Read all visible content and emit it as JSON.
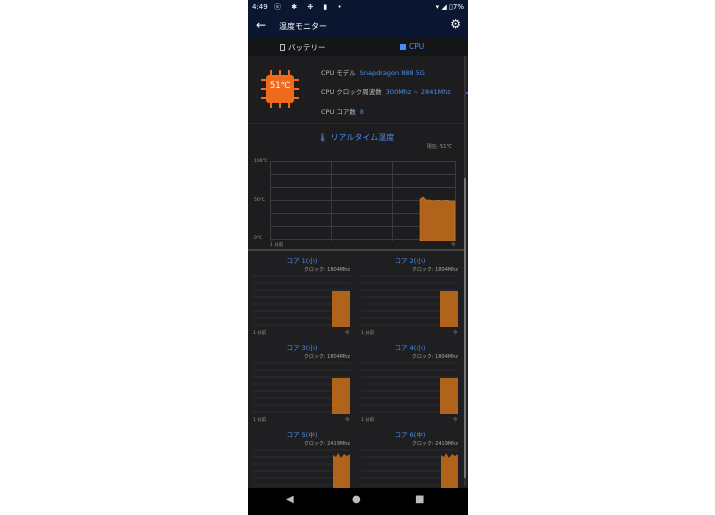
{
  "status_bar": {
    "time": "4:49",
    "icons_left": "ⓔ ✱ ❉ ▮ •",
    "battery": "7%"
  },
  "app_bar": {
    "title": "温度モニター",
    "back_icon": "←",
    "settings_icon": "⚙"
  },
  "tabs": [
    {
      "label": "バッテリー",
      "selected": false
    },
    {
      "label": "CPU",
      "selected": true
    }
  ],
  "cpu_info": {
    "temperature": "51℃",
    "model_label": "CPU モデル",
    "model_value": "Snapdragon 888 5G",
    "clock_label": "CPU クロック周波数",
    "clock_value": "300Mhz ~ 2841Mhz",
    "cores_label": "CPU コア数",
    "cores_value": "8"
  },
  "realtime": {
    "title": "リアルタイム温度",
    "current": "現在: 51℃",
    "y_labels": [
      "100℃",
      "50℃",
      "0℃"
    ],
    "x_left": "1 分前",
    "x_right": "今",
    "fill_color": "#b0631b"
  },
  "cores": [
    {
      "name": "コア 1(小)",
      "clock": "クロック: 1804Mhz",
      "x_left": "1 分前",
      "x_right": "今",
      "shape": "flat"
    },
    {
      "name": "コア 2(小)",
      "clock": "クロック: 1804Mhz",
      "x_left": "1 分前",
      "x_right": "今",
      "shape": "flat"
    },
    {
      "name": "コア 3(小)",
      "clock": "クロック: 1804Mhz",
      "x_left": "1 分前",
      "x_right": "今",
      "shape": "flat"
    },
    {
      "name": "コア 4(小)",
      "clock": "クロック: 1804Mhz",
      "x_left": "1 分前",
      "x_right": "今",
      "shape": "flat"
    },
    {
      "name": "コア 5(中)",
      "clock": "クロック: 2419Mhz",
      "shape": "wave"
    },
    {
      "name": "コア 6(中)",
      "clock": "クロック: 2419Mhz",
      "shape": "wave"
    }
  ],
  "nav": {
    "back": "◀",
    "home": "●",
    "recent": "■"
  }
}
